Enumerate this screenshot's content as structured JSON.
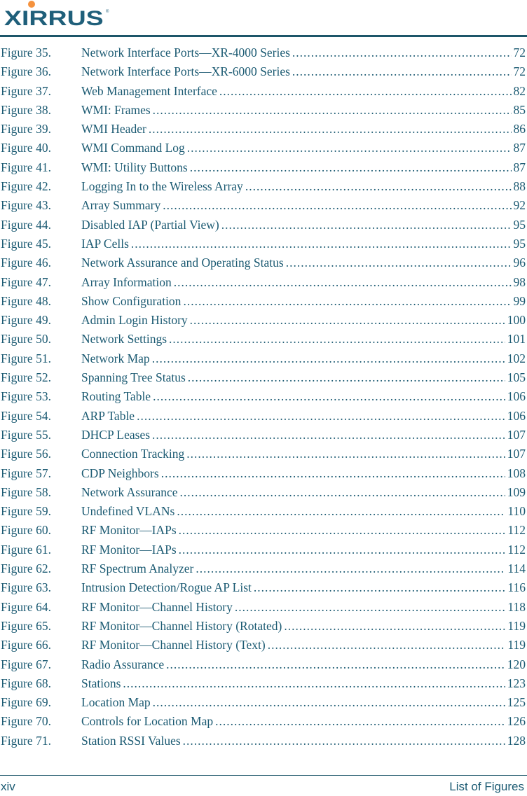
{
  "header": {
    "logo_text": "XIRRUS",
    "logo_reg": "®"
  },
  "toc": {
    "entries": [
      {
        "label": "Figure 35.",
        "title": "Network Interface Ports—XR-4000 Series",
        "page": "72"
      },
      {
        "label": "Figure 36.",
        "title": "Network Interface Ports—XR-6000 Series",
        "page": "72"
      },
      {
        "label": "Figure 37.",
        "title": "Web Management Interface ",
        "page": "82"
      },
      {
        "label": "Figure 38.",
        "title": "WMI: Frames ",
        "page": "85"
      },
      {
        "label": "Figure 39.",
        "title": "WMI Header ",
        "page": "86"
      },
      {
        "label": "Figure 40.",
        "title": "WMI Command Log ",
        "page": "87"
      },
      {
        "label": "Figure 41.",
        "title": "WMI: Utility Buttons ",
        "page": "87"
      },
      {
        "label": "Figure 42.",
        "title": "Logging In to the Wireless Array",
        "page": "88"
      },
      {
        "label": "Figure 43.",
        "title": "Array Summary",
        "page": "92"
      },
      {
        "label": "Figure 44.",
        "title": "Disabled IAP (Partial View)",
        "page": "95"
      },
      {
        "label": "Figure 45.",
        "title": "IAP Cells",
        "page": "95"
      },
      {
        "label": "Figure 46.",
        "title": "Network Assurance and Operating Status",
        "page": "96"
      },
      {
        "label": "Figure 47.",
        "title": "Array Information ",
        "page": "98"
      },
      {
        "label": "Figure 48.",
        "title": "Show Configuration",
        "page": "99"
      },
      {
        "label": "Figure 49.",
        "title": "Admin Login History",
        "page": "100"
      },
      {
        "label": "Figure 50.",
        "title": "Network Settings",
        "page": "101"
      },
      {
        "label": "Figure 51.",
        "title": "Network Map ",
        "page": "102"
      },
      {
        "label": "Figure 52.",
        "title": "Spanning Tree Status",
        "page": "105"
      },
      {
        "label": "Figure 53.",
        "title": "Routing Table",
        "page": "106"
      },
      {
        "label": "Figure 54.",
        "title": "ARP Table",
        "page": "106"
      },
      {
        "label": "Figure 55.",
        "title": "DHCP Leases",
        "page": "107"
      },
      {
        "label": "Figure 56.",
        "title": "Connection Tracking",
        "page": "107"
      },
      {
        "label": "Figure 57.",
        "title": "CDP Neighbors",
        "page": "108"
      },
      {
        "label": "Figure 58.",
        "title": "Network Assurance",
        "page": "109"
      },
      {
        "label": "Figure 59.",
        "title": "Undefined VLANs",
        "page": "110"
      },
      {
        "label": "Figure 60.",
        "title": "RF Monitor—IAPs ",
        "page": "112"
      },
      {
        "label": "Figure 61.",
        "title": "RF Monitor—IAPs ",
        "page": "112"
      },
      {
        "label": "Figure 62.",
        "title": "RF Spectrum Analyzer",
        "page": "114"
      },
      {
        "label": "Figure 63.",
        "title": "Intrusion Detection/Rogue AP List",
        "page": "116"
      },
      {
        "label": "Figure 64.",
        "title": "RF Monitor—Channel History",
        "page": "118"
      },
      {
        "label": "Figure 65.",
        "title": "RF Monitor—Channel History (Rotated)",
        "page": "119"
      },
      {
        "label": "Figure 66.",
        "title": "RF Monitor—Channel History (Text)",
        "page": "119"
      },
      {
        "label": "Figure 67.",
        "title": "Radio Assurance",
        "page": "120"
      },
      {
        "label": "Figure 68.",
        "title": "Stations",
        "page": "123"
      },
      {
        "label": "Figure 69.",
        "title": "Location Map ",
        "page": "125"
      },
      {
        "label": "Figure 70.",
        "title": "Controls for Location Map",
        "page": "126"
      },
      {
        "label": "Figure 71.",
        "title": "Station RSSI Values ",
        "page": "128"
      }
    ]
  },
  "footer": {
    "page_number": "xiv",
    "section": "List of Figures"
  }
}
